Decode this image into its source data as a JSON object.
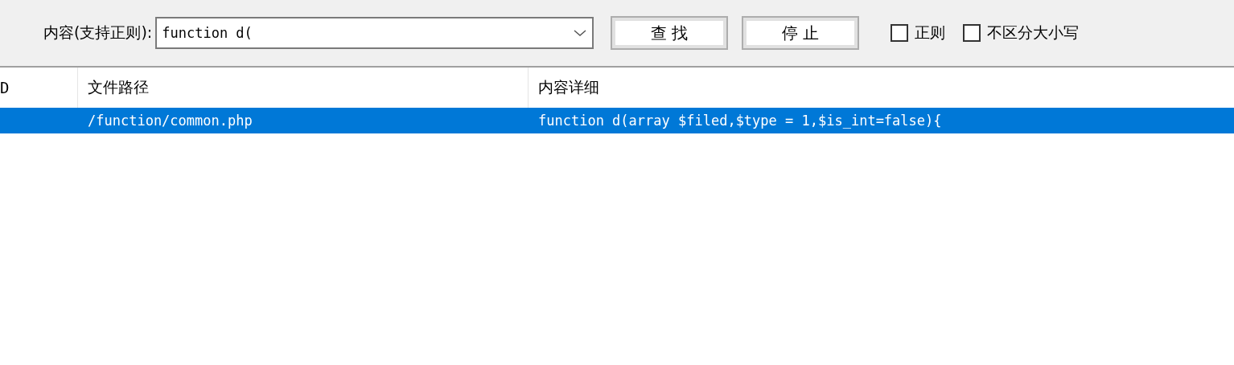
{
  "search": {
    "label": "内容(支持正则):",
    "value": "function d("
  },
  "buttons": [
    {
      "label": "查 找"
    },
    {
      "label": "停 止"
    }
  ],
  "options": [
    {
      "label": "正则",
      "checked": false
    },
    {
      "label": "不区分大小写",
      "checked": false
    }
  ],
  "table": {
    "columns": [
      "D",
      "文件路径",
      "内容详细"
    ],
    "rows": [
      {
        "selected": true,
        "cells": [
          "",
          "/function/common.php",
          "function d(array $filed,$type = 1,$is_int=false){"
        ]
      }
    ]
  }
}
